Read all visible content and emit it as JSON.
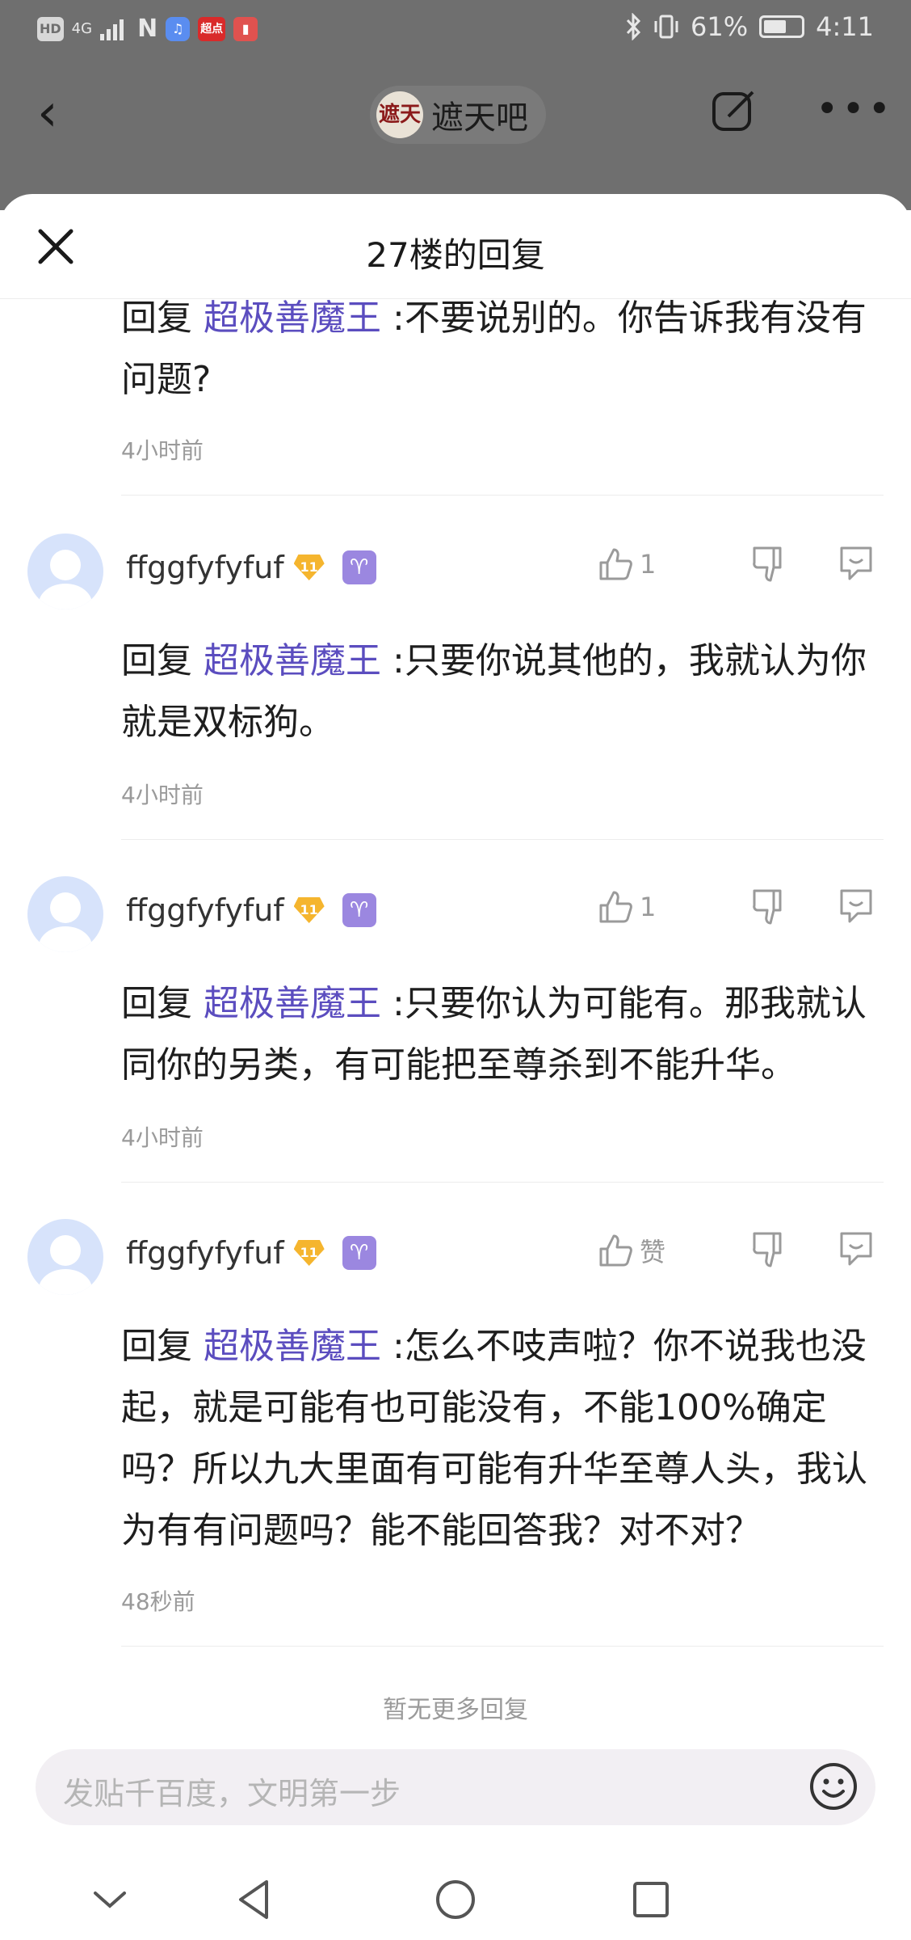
{
  "status_bar": {
    "left_items": [
      "HD",
      "4G",
      "signal",
      "NFC",
      "music-app",
      "超点",
      "book-app"
    ],
    "chip_hd": "HD",
    "chip_4g": "4G",
    "chip_nfc": "N",
    "chip_music": "♫",
    "chip_chaodian": "超点",
    "chip_book": "▮",
    "battery_percent": "61%",
    "battery_level": 0.61,
    "time": "4:11"
  },
  "top_nav": {
    "forum_name": "遮天吧",
    "forum_logo_text": "遮天"
  },
  "sheet": {
    "title": "27楼的回复"
  },
  "replies": [
    {
      "prefix": "回复",
      "mention": "超极善魔王",
      "body": ":不要说别的。你告诉我有没有问题?",
      "time": "4小时前"
    },
    {
      "username": "ffggfyfyfuf",
      "level": "11",
      "zodiac": "♈",
      "likes": "1",
      "prefix": "回复",
      "mention": "超极善魔王",
      "body": ":只要你说其他的，我就认为你就是双标狗。",
      "time": "4小时前"
    },
    {
      "username": "ffggfyfyfuf",
      "level": "11",
      "zodiac": "♈",
      "likes": "1",
      "prefix": "回复",
      "mention": "超极善魔王",
      "body": ":只要你认为可能有。那我就认同你的另类，有可能把至尊杀到不能升华。",
      "time": "4小时前"
    },
    {
      "username": "ffggfyfyfuf",
      "level": "11",
      "zodiac": "♈",
      "likes": "赞",
      "prefix": "回复",
      "mention": "超极善魔王",
      "body": ":怎么不吱声啦？你不说我也没起，就是可能有也可能没有，不能100%确定吗？所以九大里面有可能有升华至尊人头，我认为有有问题吗？能不能回答我？对不对？",
      "time": "48秒前"
    }
  ],
  "no_more": "暂无更多回复",
  "input": {
    "placeholder": "发贴千百度，文明第一步"
  }
}
